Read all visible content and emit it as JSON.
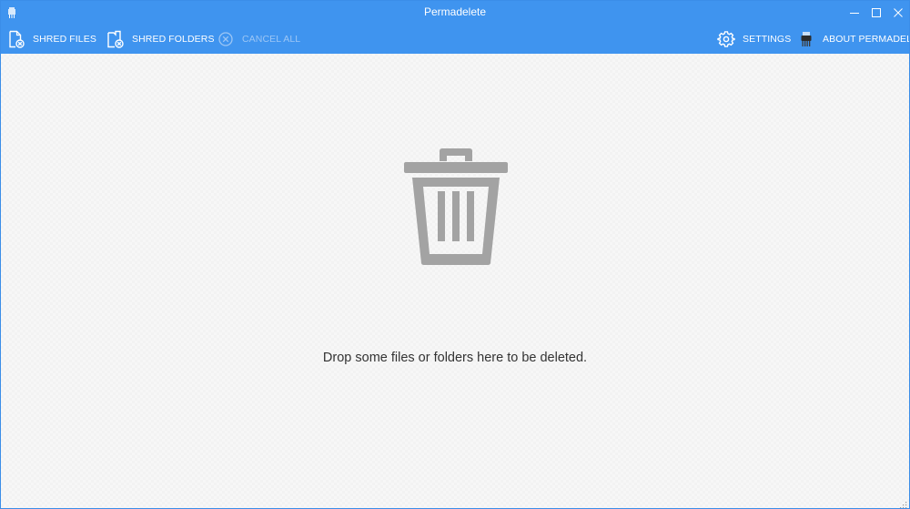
{
  "window": {
    "title": "Permadelete",
    "accent_color": "#3f94ef"
  },
  "toolbar": {
    "shred_files": {
      "label": "SHRED FILES",
      "icon": "file-shred-icon"
    },
    "shred_folders": {
      "label": "SHRED FOLDERS",
      "icon": "folder-shred-icon"
    },
    "cancel_all": {
      "label": "CANCEL ALL",
      "icon": "cancel-circle-icon",
      "enabled": false
    },
    "settings": {
      "label": "SETTINGS",
      "icon": "gear-icon"
    },
    "about": {
      "label": "ABOUT PERMADELETE",
      "icon": "shredder-icon"
    }
  },
  "main": {
    "drop_message": "Drop some files or folders here to be deleted.",
    "icon": "trash-icon",
    "icon_color": "#a3a3a3"
  }
}
